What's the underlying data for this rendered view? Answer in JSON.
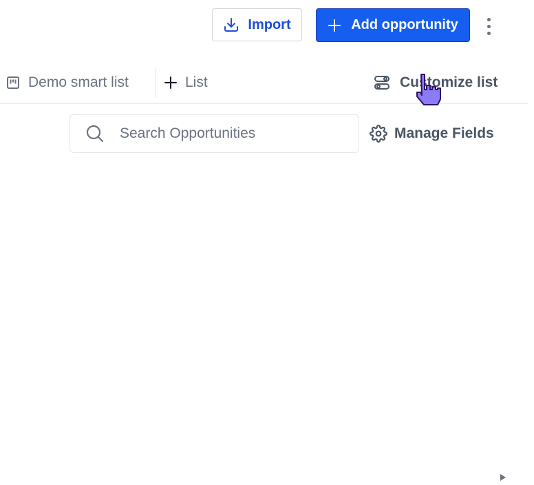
{
  "header": {
    "import_label": "Import",
    "add_label": "Add opportunity"
  },
  "tabs": {
    "smart_list_label": "Demo smart list",
    "add_list_label": "List",
    "customize_label": "Customize list"
  },
  "search": {
    "placeholder": "Search Opportunities"
  },
  "manage_fields_label": "Manage Fields",
  "colors": {
    "primary": "#155eef",
    "import_text": "#1d4ed8",
    "muted_text": "#6b7280",
    "cursor": "#8b7cf6"
  }
}
